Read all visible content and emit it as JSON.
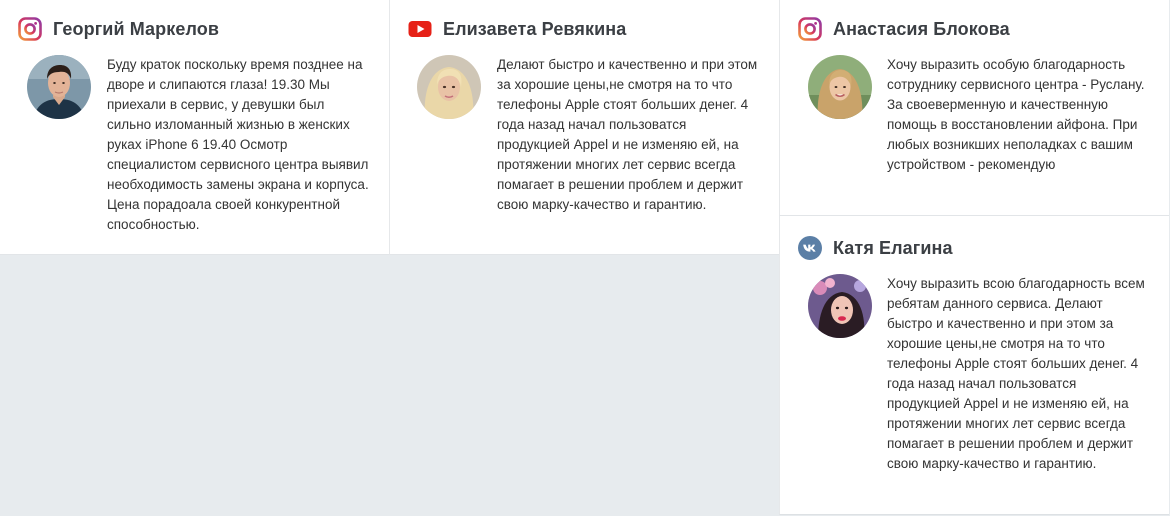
{
  "reviews": [
    {
      "network": "instagram",
      "network_icon": "instagram-icon",
      "author": "Георгий Маркелов",
      "text": "Буду краток поскольку время позднее на дворе и слипаются глаза! 19.30 Мы приехали в сервис, у девушки был сильно изломанный жизнью в женских руках iPhone 6 19.40 Осмотр специалистом сервисного центра выявил необходимость замены экрана и корпуса. Цена порадоала своей конкурентной способностью."
    },
    {
      "network": "youtube",
      "network_icon": "youtube-icon",
      "author": "Елизавета Ревякина",
      "text": "Делают быстро и качественно и при этом за хорошие цены,не смотря на то что телефоны Apple стоят больших денег. 4 года назад начал пользоватся продукцией Appel и не изменяю ей, на протяжении многих лет сервис всегда помагает в решении проблем и держит свою марку-качество и гарантию."
    },
    {
      "network": "instagram",
      "network_icon": "instagram-icon",
      "author": "Анастасия Блокова",
      "text": "Хочу выразить особую благодарность сотруднику сервисного центра - Руслану. За своеверменную и качественную помощь в восстановлении айфона. При любых возникших неполадках с вашим устройством - рекомендую"
    },
    {
      "network": "vk",
      "network_icon": "vk-icon",
      "author": "Катя Елагина",
      "text": "Хочу выразить всою благодарность всем ребятам данного сервиса. Делают быстро и качественно и при этом за хорошие цены,не смотря на то что телефоны Apple стоят больших денег. 4 года назад начал пользоватся продукцией Appel и не изменяю ей, на протяжении многих лет сервис всегда помагает в решении проблем и держит свою марку-качество и гарантию."
    }
  ],
  "colors": {
    "instagram": "#c1356f",
    "youtube": "#e62117",
    "vk": "#5b7fa6",
    "page_background": "#e7ebee",
    "card_background": "#ffffff"
  }
}
